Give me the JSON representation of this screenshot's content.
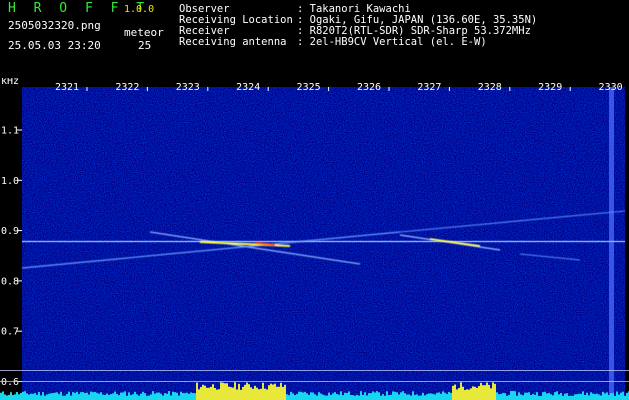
{
  "header": {
    "app_title": "H R O F F T",
    "app_version": "1.0.0",
    "filename": "2505032320.png",
    "meteor_label": "meteor",
    "datetime": "25.05.03 23:20",
    "meteor_count": "25"
  },
  "info": [
    {
      "key": "Observer",
      "value": ": Takanori Kawachi"
    },
    {
      "key": "Receiving Location",
      "value": ": Ogaki, Gifu, JAPAN (136.60E, 35.35N)"
    },
    {
      "key": "Receiver",
      "value": ": R820T2(RTL-SDR) SDR-Sharp 53.372MHz"
    },
    {
      "key": "Receiving antenna",
      "value": ": 2el-HB9CV Vertical (el. E-W)"
    }
  ],
  "chart_data": {
    "type": "heatmap",
    "ylabel": "kHz",
    "time_ticks": [
      "2321",
      "2322",
      "2323",
      "2324",
      "2325",
      "2326",
      "2327",
      "2328",
      "2329",
      "2330"
    ],
    "freq_ticks": [
      "1.1",
      "1.0",
      "0.9",
      "0.8",
      "0.7",
      "0.6"
    ],
    "freq_values": [
      1.1,
      1.0,
      0.9,
      0.8,
      0.7,
      0.6
    ],
    "ylim": [
      0.58,
      1.18
    ],
    "colors": {
      "background": "#00008a",
      "trace": "#ffff00",
      "baseline": "#00e0ff",
      "grid": "#c8c8ff"
    }
  }
}
